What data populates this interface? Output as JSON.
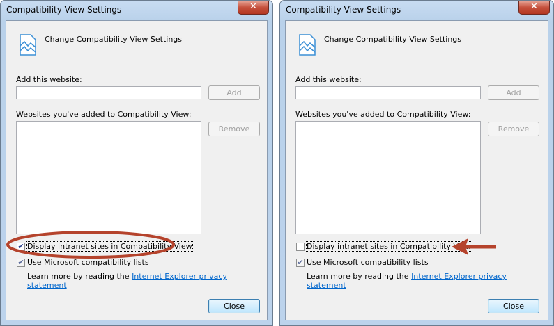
{
  "dialogs": [
    {
      "title": "Compatibility View Settings",
      "heading": "Change Compatibility View Settings",
      "add_label": "Add this website:",
      "add_input_value": "",
      "add_button": "Add",
      "list_label": "Websites you've added to Compatibility View:",
      "remove_button": "Remove",
      "intranet_label": "Display intranet sites in Compatibility View",
      "intranet_checked": true,
      "ms_lists_label": "Use Microsoft compatibility lists",
      "ms_lists_checked": true,
      "learn_more": "Learn more by reading the",
      "privacy_link": "Internet Explorer privacy statement",
      "close_button": "Close",
      "close_x": "✕"
    },
    {
      "title": "Compatibility View Settings",
      "heading": "Change Compatibility View Settings",
      "add_label": "Add this website:",
      "add_input_value": "",
      "add_button": "Add",
      "list_label": "Websites you've added to Compatibility View:",
      "remove_button": "Remove",
      "intranet_label": "Display intranet sites in Compatibility View",
      "intranet_checked": false,
      "ms_lists_label": "Use Microsoft compatibility lists",
      "ms_lists_checked": true,
      "learn_more": "Learn more by reading the",
      "privacy_link": "Internet Explorer privacy statement",
      "close_button": "Close",
      "close_x": "✕"
    }
  ],
  "colors": {
    "annotation": "#b5432c"
  }
}
